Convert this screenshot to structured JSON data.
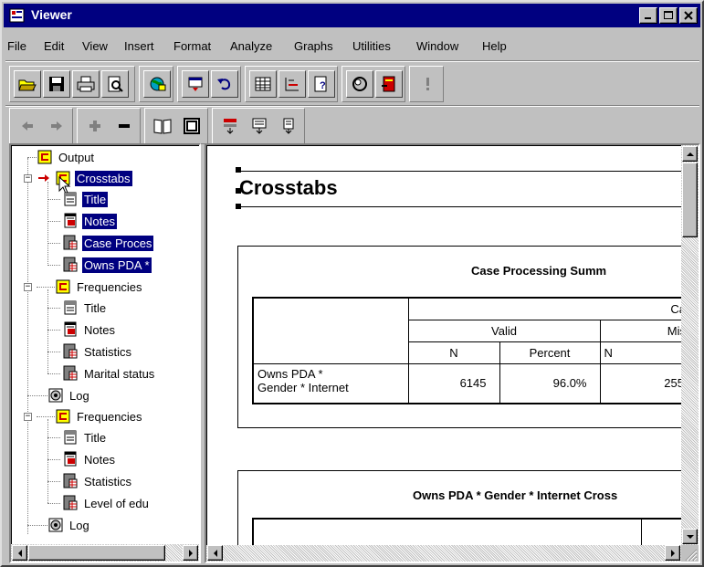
{
  "window": {
    "title": "Viewer",
    "caption_buttons": [
      "minimize",
      "maximize",
      "close"
    ]
  },
  "menu": [
    "File",
    "Edit",
    "View",
    "Insert",
    "Format",
    "Analyze",
    "Graphs",
    "Utilities",
    "Window",
    "Help"
  ],
  "toolbar1": [
    "open-icon",
    "save-icon",
    "print-icon",
    "print-preview-icon",
    "export-icon",
    "recall-dialog-icon",
    "undo-icon",
    "goto-data-icon",
    "goto-case-icon",
    "variables-icon",
    "use-sets-icon",
    "designate-window-icon",
    "run-icon"
  ],
  "toolbar2": [
    "previous-icon",
    "next-icon",
    "promote-icon",
    "demote-icon",
    "show-all-icon",
    "hide-icon",
    "insert-heading-icon",
    "insert-title-icon",
    "insert-text-icon"
  ],
  "tree": {
    "items": [
      {
        "label": "Output",
        "icon": "output-book-icon",
        "selected": false
      },
      {
        "label": "Crosstabs",
        "icon": "procedure-book-icon",
        "selected": true
      },
      {
        "label": "Title",
        "icon": "title-icon",
        "selected": true
      },
      {
        "label": "Notes",
        "icon": "notes-icon",
        "selected": true
      },
      {
        "label": "Case Proces",
        "icon": "table-icon",
        "selected": true
      },
      {
        "label": "Owns PDA *",
        "icon": "table-icon",
        "selected": true
      },
      {
        "label": "Frequencies",
        "icon": "procedure-book-icon",
        "selected": false
      },
      {
        "label": "Title",
        "icon": "title-icon",
        "selected": false
      },
      {
        "label": "Notes",
        "icon": "notes-icon",
        "selected": false
      },
      {
        "label": "Statistics",
        "icon": "table-icon",
        "selected": false
      },
      {
        "label": "Marital status",
        "icon": "table-icon",
        "selected": false
      },
      {
        "label": "Log",
        "icon": "log-icon",
        "selected": false
      },
      {
        "label": "Frequencies",
        "icon": "procedure-book-icon",
        "selected": false
      },
      {
        "label": "Title",
        "icon": "title-icon",
        "selected": false
      },
      {
        "label": "Notes",
        "icon": "notes-icon",
        "selected": false
      },
      {
        "label": "Statistics",
        "icon": "table-icon",
        "selected": false
      },
      {
        "label": "Level of edu",
        "icon": "table-icon",
        "selected": false
      },
      {
        "label": "Log",
        "icon": "log-icon",
        "selected": false
      }
    ]
  },
  "content": {
    "heading": "Crosstabs",
    "case_table": {
      "title": "Case Processing Summ",
      "header_cases": "Ca",
      "header_valid": "Valid",
      "header_missing": "Mis",
      "col_n": "N",
      "col_percent": "Percent",
      "col_n2": "N",
      "row_label_1": "Owns PDA *",
      "row_label_2": "Gender * Internet",
      "valid_n": "6145",
      "valid_percent": "96.0%",
      "missing_n": "255"
    },
    "crosstab_title": "Owns PDA * Gender * Internet Cross"
  }
}
